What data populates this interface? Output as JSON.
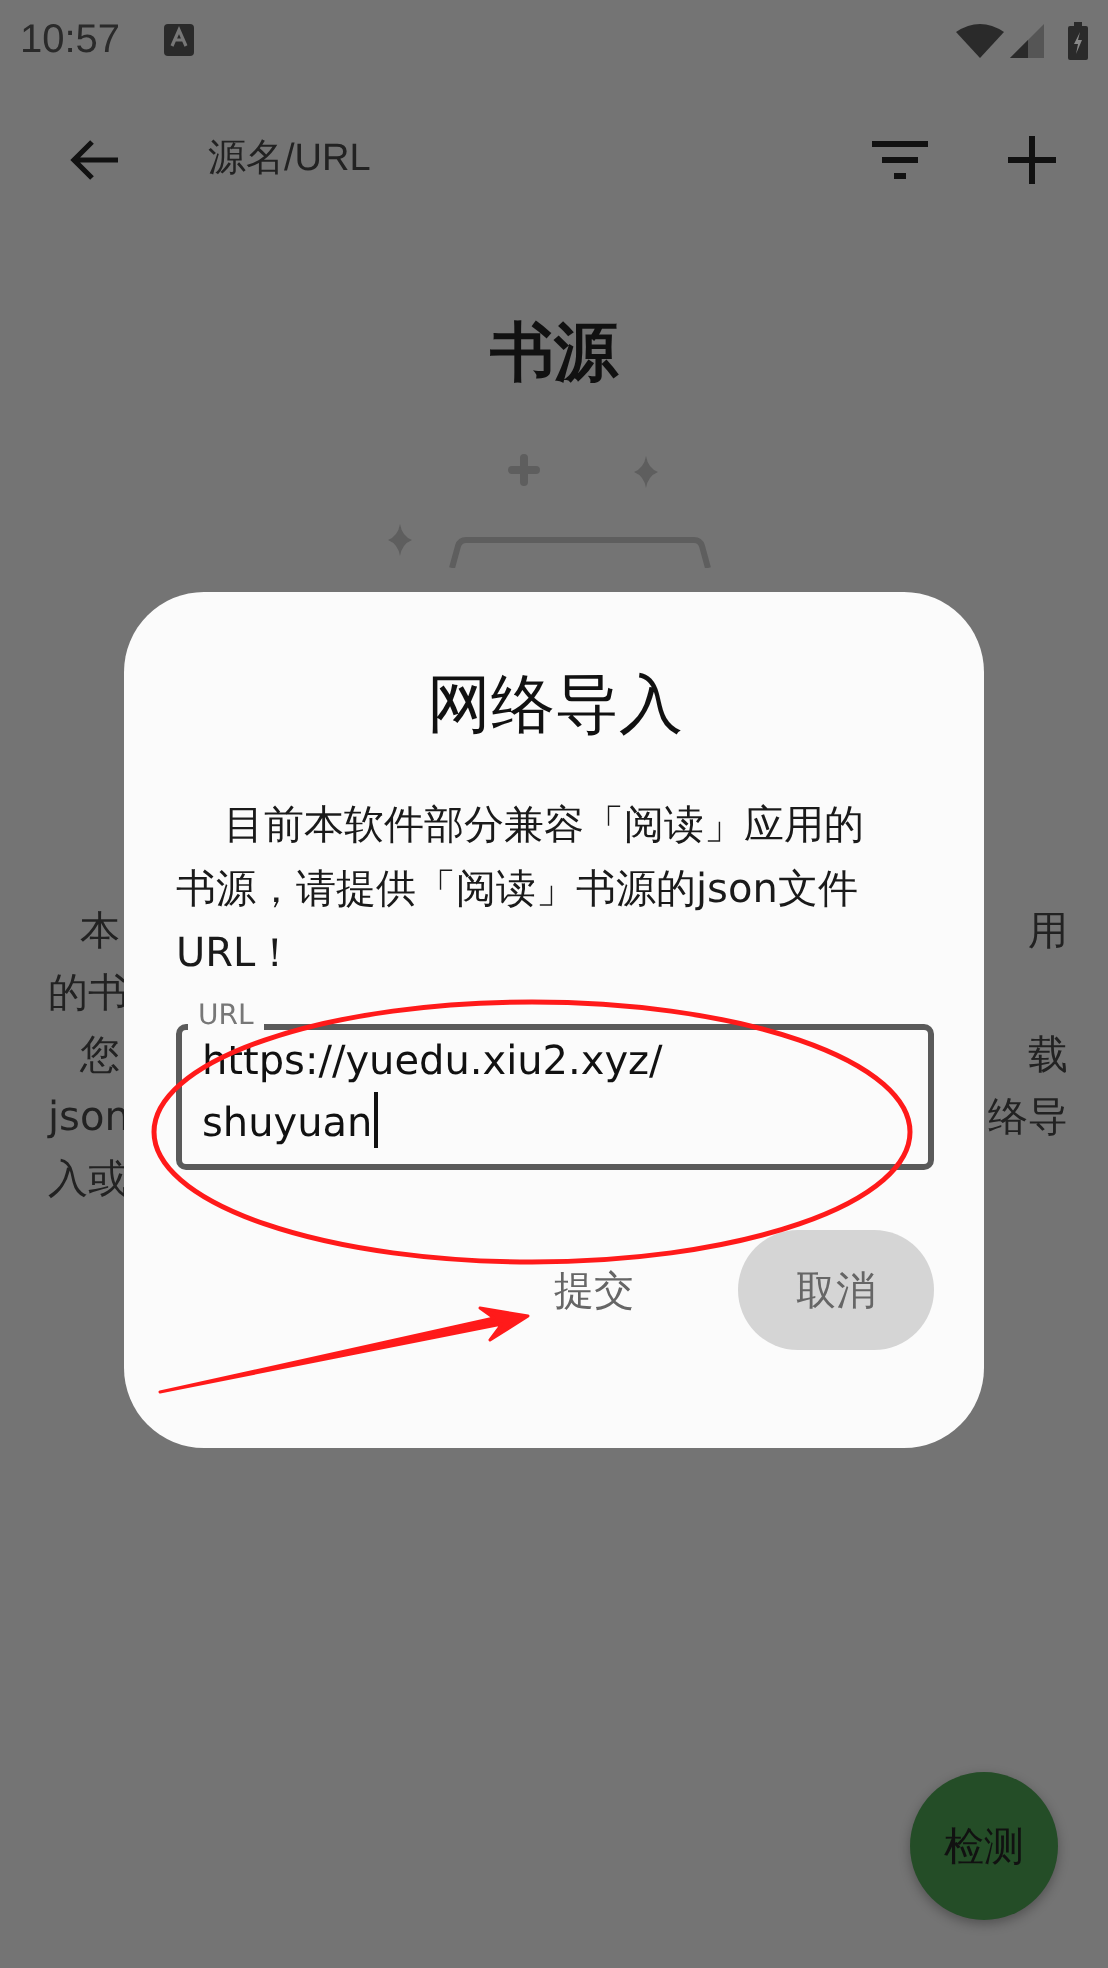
{
  "status_bar": {
    "time": "10:57"
  },
  "app_bar": {
    "search_placeholder": "源名/URL"
  },
  "page": {
    "title": "书源",
    "lines": [
      {
        "left": "本",
        "right": "用",
        "paragraph_start": true
      },
      {
        "left": "的书",
        "paragraph_start": false
      },
      {
        "left": "您",
        "right": "载",
        "paragraph_start": true
      },
      {
        "left": "json",
        "right": "络导",
        "paragraph_start": false
      },
      {
        "left": "入或",
        "paragraph_start": false
      }
    ]
  },
  "dialog": {
    "title": "网络导入",
    "message": "目前本软件部分兼容「阅读」应用的书源，请提供「阅读」书源的json文件URL！",
    "field": {
      "label": "URL",
      "value": "https://yuedu.xiu2.xyz/shuyuan",
      "focused": true
    },
    "buttons": [
      {
        "label": "提交",
        "kind": "text"
      },
      {
        "label": "取消",
        "kind": "filled"
      }
    ]
  },
  "fab": {
    "label": "检测"
  }
}
